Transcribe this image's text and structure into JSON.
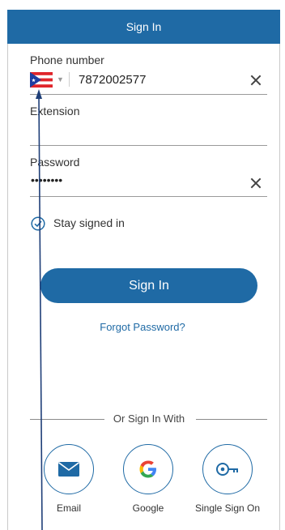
{
  "header": {
    "title": "Sign In"
  },
  "form": {
    "phone_label": "Phone number",
    "phone_value": "7872002577",
    "extension_label": "Extension",
    "password_label": "Password",
    "password_value": "••••••••",
    "stay_signed_in_label": "Stay signed in",
    "stay_signed_in_checked": true
  },
  "actions": {
    "sign_in_label": "Sign In",
    "forgot_password_label": "Forgot Password?"
  },
  "alt_signin": {
    "divider_label": "Or Sign In With",
    "options": [
      {
        "label": "Email",
        "icon": "email-icon"
      },
      {
        "label": "Google",
        "icon": "google-icon"
      },
      {
        "label": "Single Sign On",
        "icon": "key-icon"
      }
    ]
  },
  "colors": {
    "primary": "#1f6aa5",
    "header_text": "#ffffff"
  }
}
